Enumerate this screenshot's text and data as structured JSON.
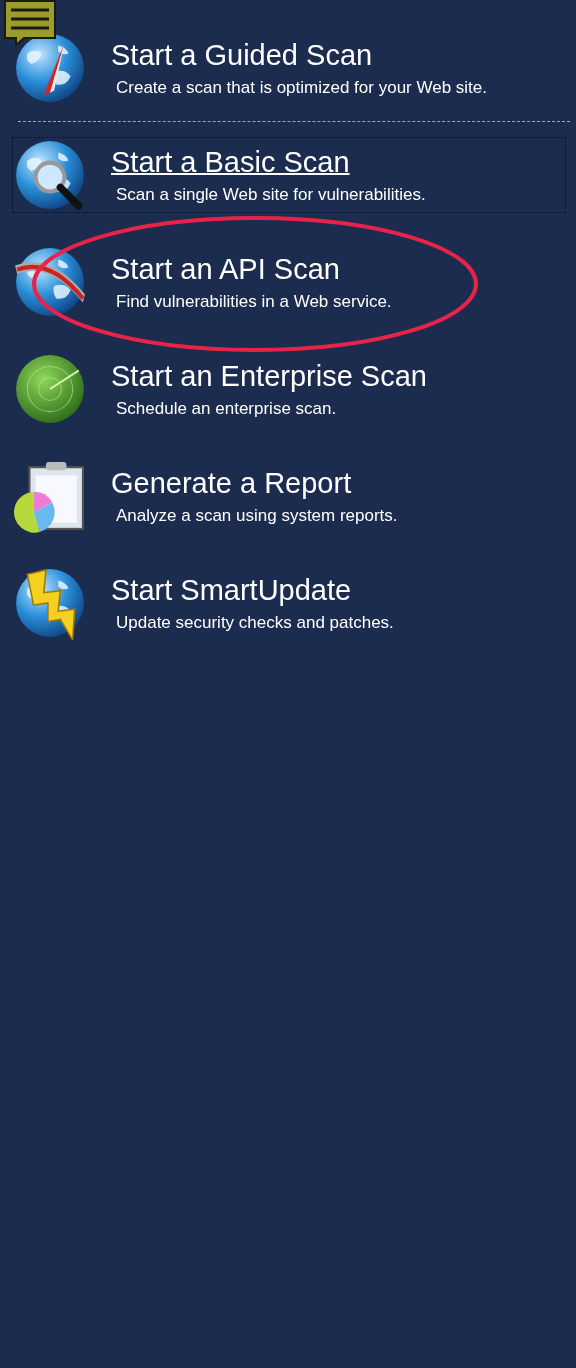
{
  "groups": [
    {
      "items": [
        {
          "kind": "compass",
          "title": "Start a Guided Scan",
          "description": "Create a scan that is optimized for your Web site.",
          "focused": false,
          "highlighted": false
        }
      ]
    },
    {
      "items": [
        {
          "kind": "magnifier",
          "title": "Start a Basic Scan",
          "description": "Scan a single Web site for vulnerabilities.",
          "focused": true,
          "highlighted": false
        },
        {
          "kind": "ring",
          "title": "Start an API Scan",
          "description": "Find vulnerabilities in a Web service.",
          "focused": false,
          "highlighted": true
        },
        {
          "kind": "radar",
          "title": "Start an Enterprise Scan",
          "description": "Schedule an enterprise scan.",
          "focused": false,
          "highlighted": false
        },
        {
          "kind": "report",
          "title": "Generate a Report",
          "description": "Analyze a scan using system reports.",
          "focused": false,
          "highlighted": false
        },
        {
          "kind": "lightning",
          "title": "Start SmartUpdate",
          "description": "Update security checks and patches.",
          "focused": false,
          "highlighted": false
        }
      ]
    }
  ]
}
